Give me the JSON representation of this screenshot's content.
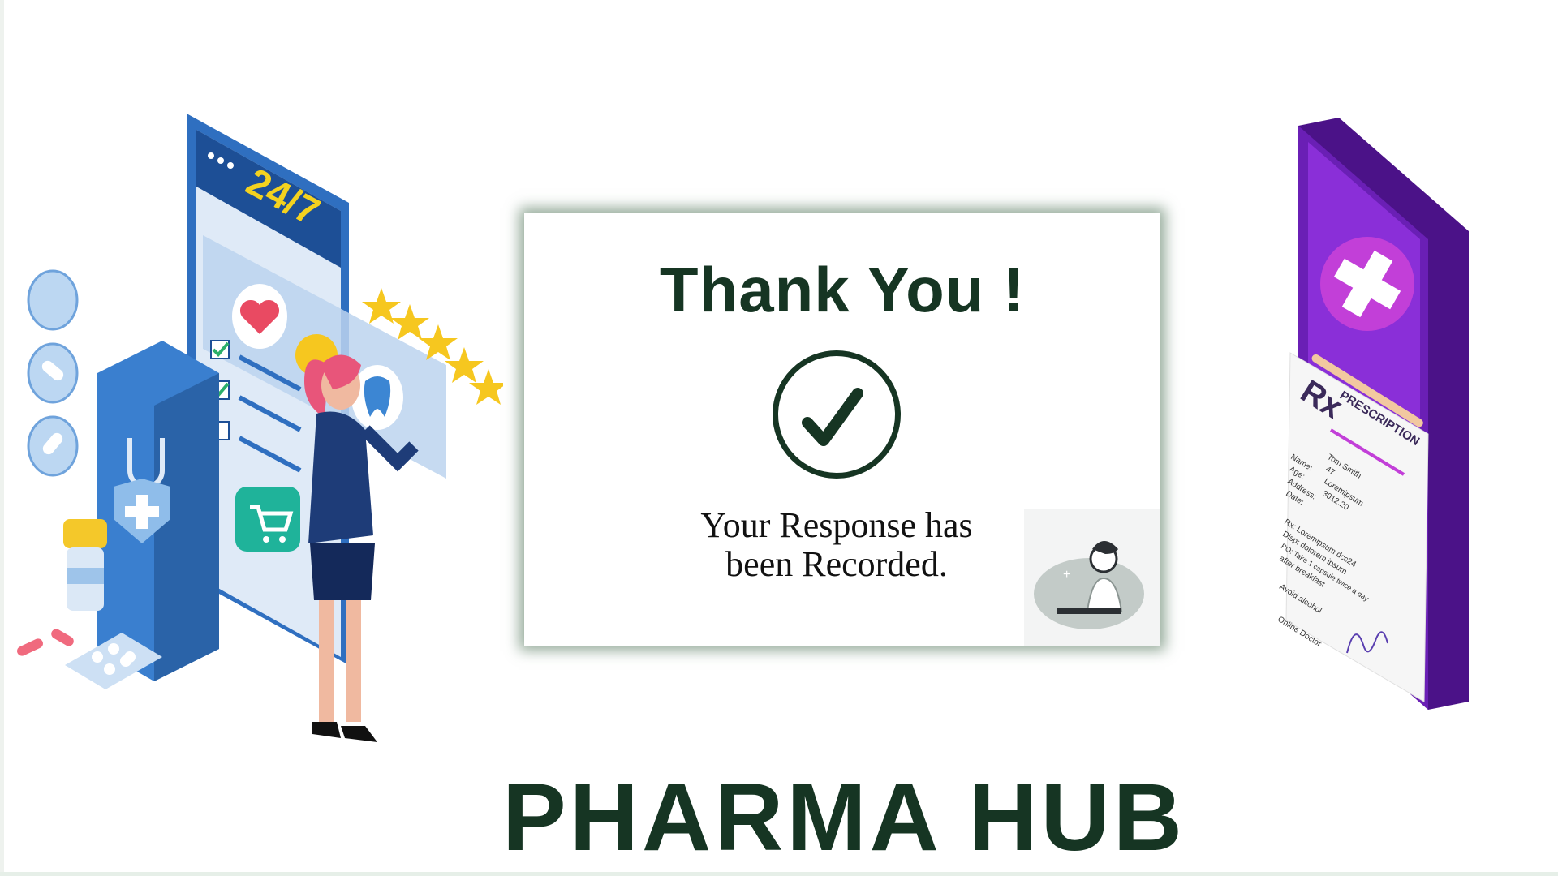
{
  "card": {
    "title": "Thank You !",
    "message_line1": "Your Response has",
    "message_line2": "been Recorded."
  },
  "brand": {
    "name": "PHARMA HUB"
  },
  "left_illustration": {
    "phone_badge": "24/7",
    "icons": [
      "heart-icon",
      "tooth-icon",
      "cart-icon",
      "pill-icon",
      "shopping-bag-icon",
      "star-rating-icon"
    ],
    "rating_stars": 5
  },
  "right_illustration": {
    "rx_symbol": "Rx",
    "heading": "PRESCRIPTION",
    "fields": [
      "Name:",
      "Age:",
      "Address:",
      "Date:"
    ],
    "values": [
      "Tom Smith",
      "47",
      "Loremipsum",
      "3012.20"
    ],
    "rx_lines": [
      "Rx: Loremipsum dcc24",
      "Disp: dolorem ipsum",
      "PO: Take 1 capsule twice a day",
      "after breakfast"
    ],
    "note": "Avoid alcohol",
    "signature_label": "Online Doctor"
  },
  "colors": {
    "brand_green": "#163523",
    "card_shadow": "#3c6446",
    "phone_blue": "#1f5aa8",
    "phone_purple": "#6a1fb5"
  }
}
